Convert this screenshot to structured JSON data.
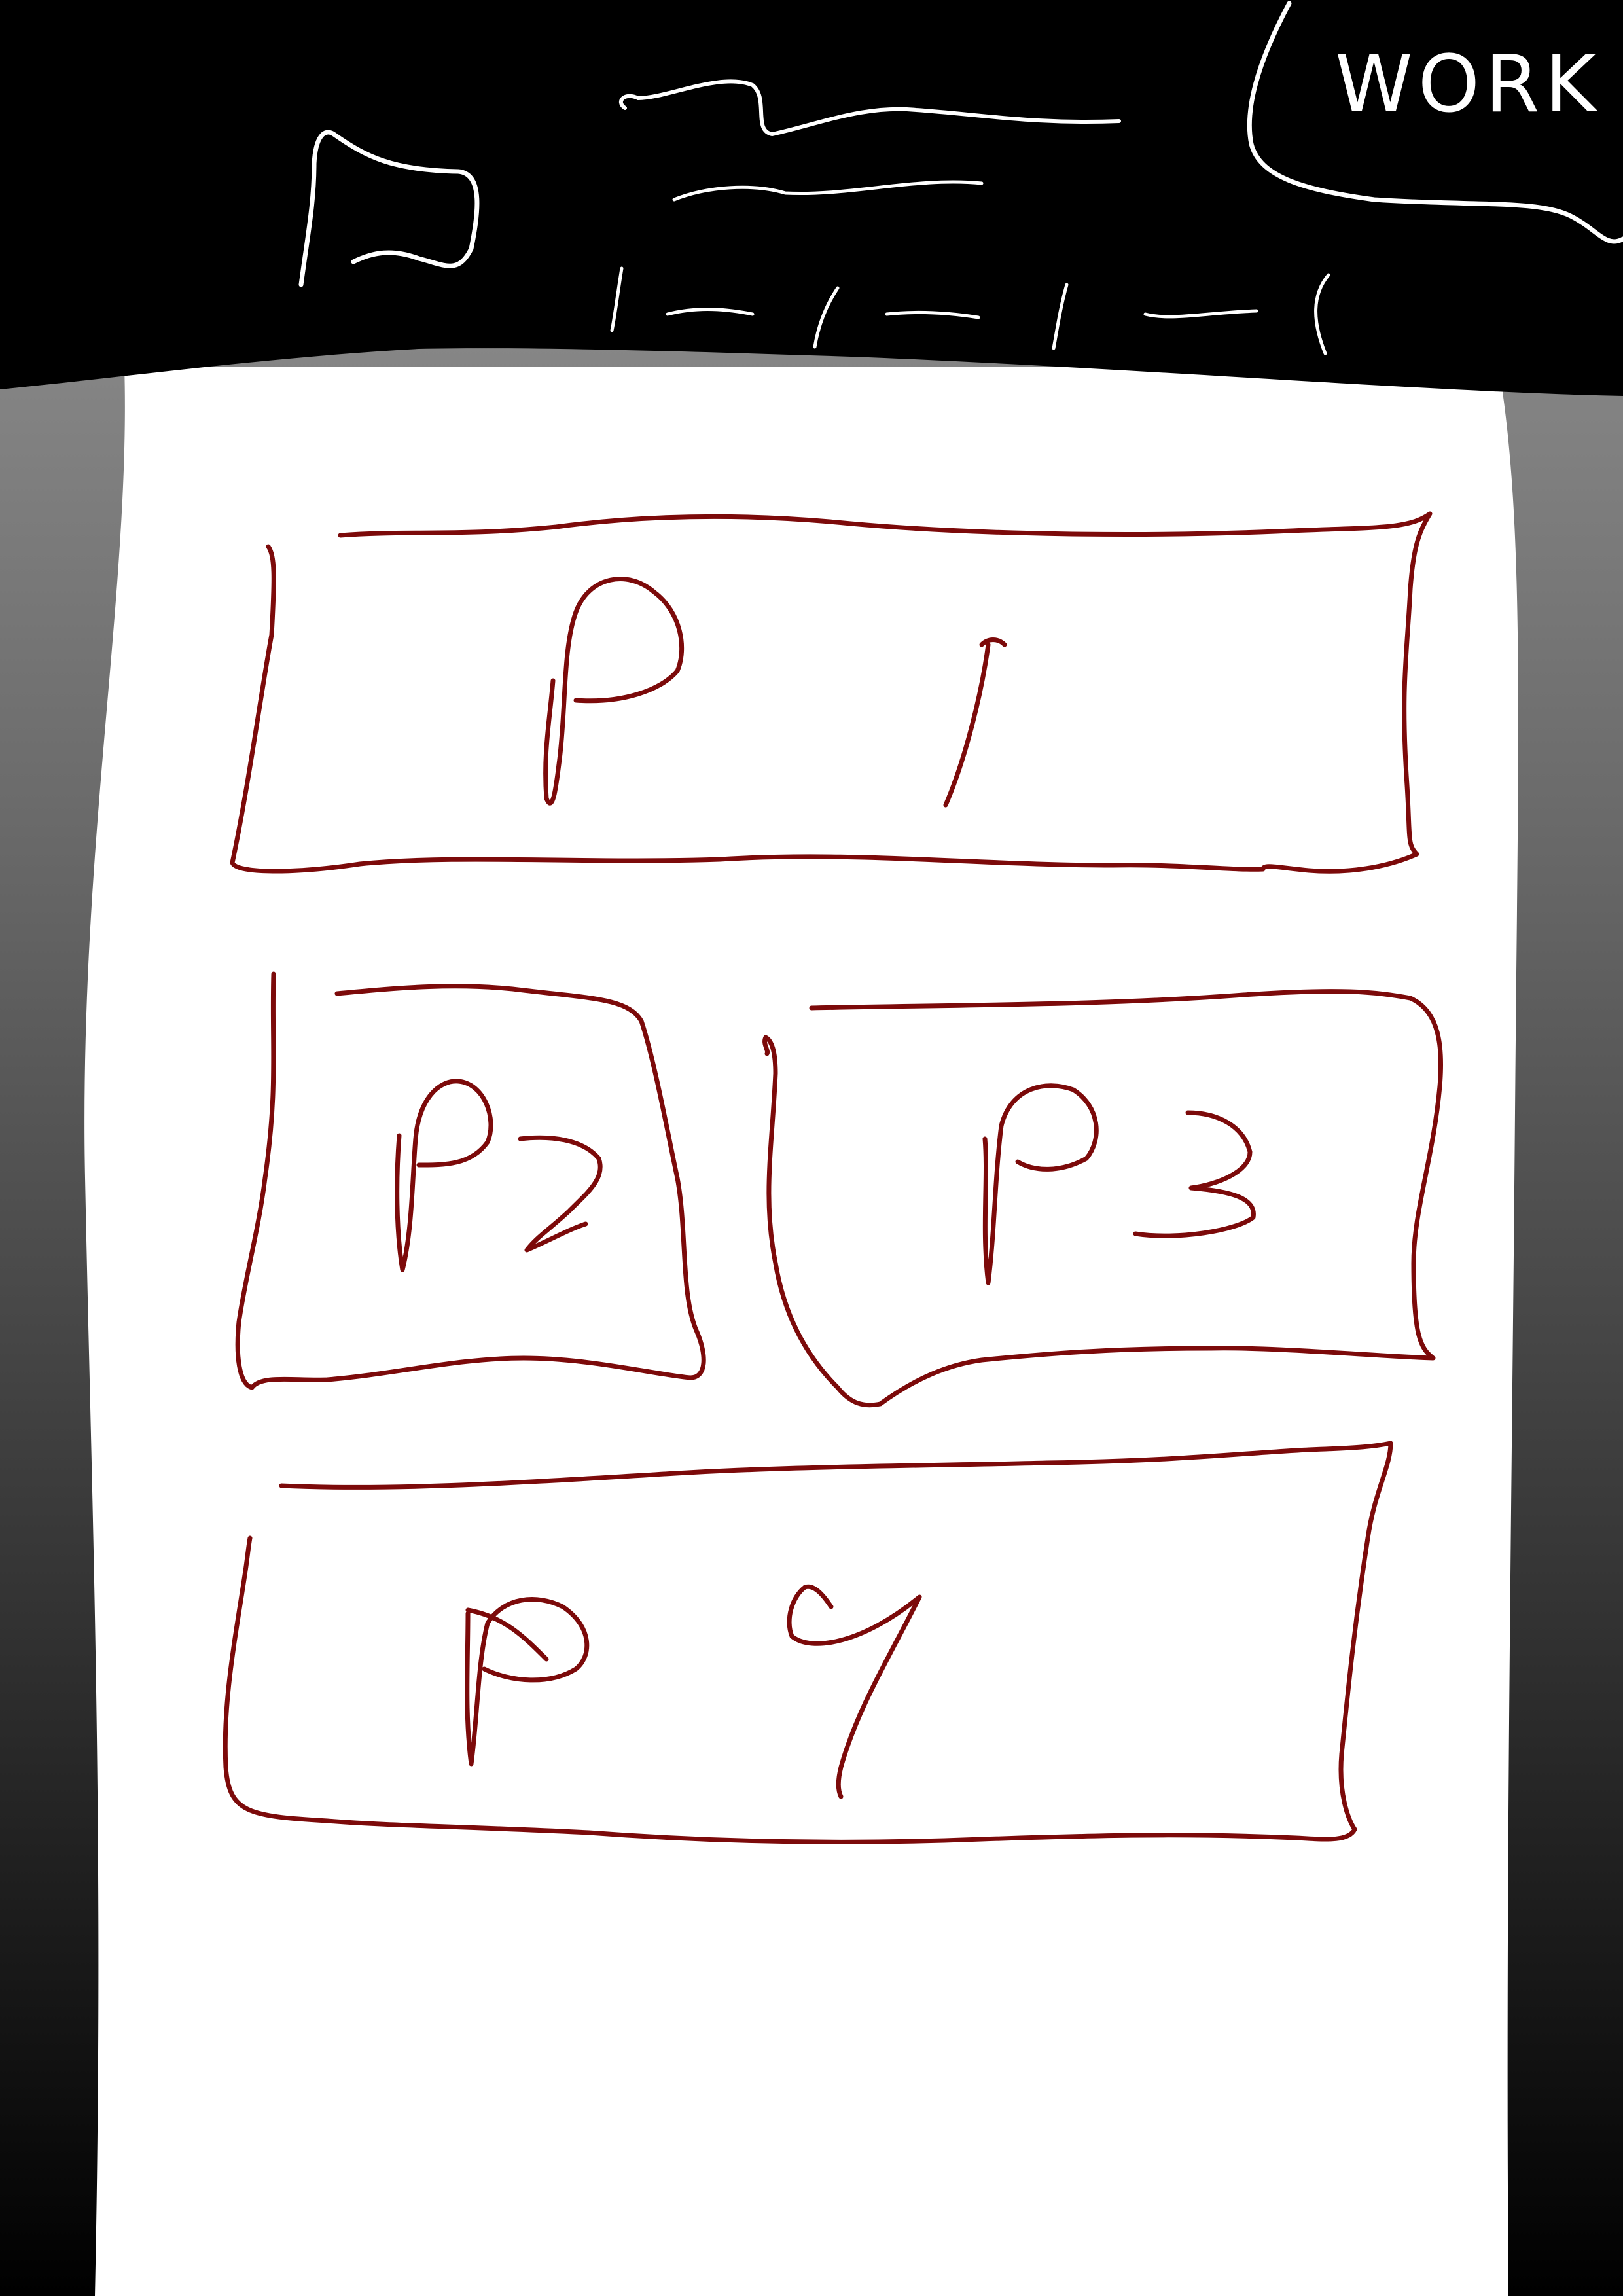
{
  "header": {
    "work_label": "WORK"
  },
  "panels": [
    {
      "label": "P1"
    },
    {
      "label": "P2"
    },
    {
      "label": "P3"
    },
    {
      "label": "P4"
    }
  ],
  "colors": {
    "header_bg": "#000000",
    "page_bg": "#ffffff",
    "panel_stroke": "#7c0a0a",
    "sketch_white": "#ffffff"
  }
}
